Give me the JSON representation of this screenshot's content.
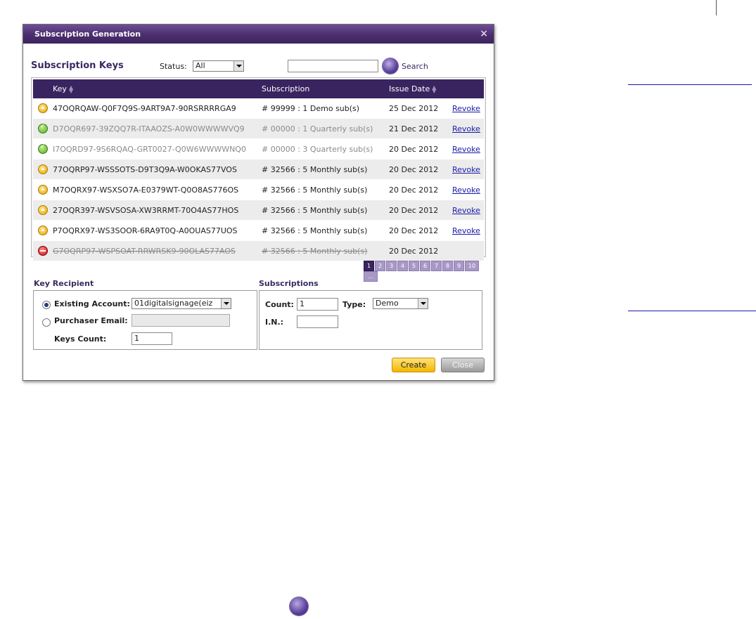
{
  "dialog": {
    "title": "Subscription Generation",
    "close_glyph": "×"
  },
  "keys_section": {
    "title": "Subscription Keys",
    "status_label": "Status:",
    "status_value": "All",
    "search_value": "",
    "search_label": "Search"
  },
  "table": {
    "headers": {
      "key": "Key",
      "subscription": "Subscription",
      "issue_date": "Issue Date"
    },
    "rows": [
      {
        "status": "pending",
        "key": "47OQRQAW-Q0F7Q9S-9ART9A7-90RSRRRRGA9",
        "subscription": "# 99999 : 1 Demo sub(s)",
        "date": "25 Dec 2012",
        "action": "Revoke"
      },
      {
        "status": "active",
        "key": "D7OQR697-39ZQQ7R-ITAAOZS-A0W0WWWWVQ9",
        "subscription": "# 00000 : 1 Quarterly sub(s)",
        "date": "21 Dec 2012",
        "action": "Revoke"
      },
      {
        "status": "active",
        "key": "I7OQRD97-9S6RQAQ-GRT0027-Q0W6WWWWNQ0",
        "subscription": "# 00000 : 3 Quarterly sub(s)",
        "date": "20 Dec 2012",
        "action": "Revoke"
      },
      {
        "status": "pending",
        "key": "77OQRP97-WSSSOTS-D9T3Q9A-W0OKAS77VOS",
        "subscription": "# 32566 : 5 Monthly sub(s)",
        "date": "20 Dec 2012",
        "action": "Revoke"
      },
      {
        "status": "pending",
        "key": "M7OQRX97-WSXSO7A-E0379WT-Q0O8AS776OS",
        "subscription": "# 32566 : 5 Monthly sub(s)",
        "date": "20 Dec 2012",
        "action": "Revoke"
      },
      {
        "status": "pending",
        "key": "27OQR397-WSVSOSA-XW3RRMT-70O4AS77HOS",
        "subscription": "# 32566 : 5 Monthly sub(s)",
        "date": "20 Dec 2012",
        "action": "Revoke"
      },
      {
        "status": "pending",
        "key": "P7OQRX97-WS3SOOR-6RA9T0Q-A0OUAS77UOS",
        "subscription": "# 32566 : 5 Monthly sub(s)",
        "date": "20 Dec 2012",
        "action": "Revoke"
      },
      {
        "status": "revoked",
        "key": "G7OQRP97-WSPSOAT-RRWRSK9-90OLAS77AOS",
        "subscription": "# 32566 : 5 Monthly sub(s)",
        "date": "20 Dec 2012",
        "action": ""
      }
    ]
  },
  "pager": {
    "pages": [
      "1",
      "2",
      "3",
      "4",
      "5",
      "6",
      "7",
      "8",
      "9",
      "10",
      "..."
    ],
    "current": "1"
  },
  "key_recipient": {
    "title": "Key Recipient",
    "existing_label": "Existing Account:",
    "existing_value": "01digitalsignage(eiz",
    "purchaser_label": "Purchaser Email:",
    "purchaser_value": "",
    "keys_count_label": "Keys Count:",
    "keys_count_value": "1"
  },
  "subscriptions": {
    "title": "Subscriptions",
    "count_label": "Count:",
    "count_value": "1",
    "type_label": "Type:",
    "type_value": "Demo",
    "in_label": "I.N.:",
    "in_value": ""
  },
  "buttons": {
    "create": "Create",
    "close": "Close"
  },
  "colors": {
    "title_bar": "#4b2d6e",
    "table_header": "#3a2460",
    "section_title": "#3a2a62",
    "link": "#1a1aa6",
    "create_button": "#f2b700",
    "close_button": "#9a9a9a"
  }
}
